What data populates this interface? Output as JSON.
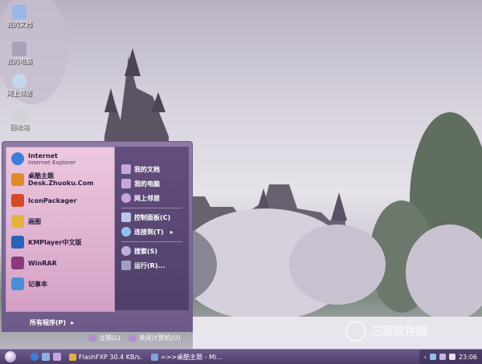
{
  "desktop_icons": [
    {
      "label": "我的文档",
      "icon": "documents-icon",
      "color": "#9bb7e8"
    },
    {
      "label": "我的电脑",
      "icon": "computer-icon",
      "color": "#a7a2b8"
    },
    {
      "label": "网上邻居",
      "icon": "network-icon",
      "color": "#c6d8f0"
    },
    {
      "label": "回收站",
      "icon": "recycle-bin-icon",
      "color": "#d3d3da"
    }
  ],
  "start_menu": {
    "left_items": [
      {
        "title": "Internet",
        "subtitle": "Internet Explorer",
        "icon": "internet-explorer-icon",
        "color": "#3b7fd6"
      },
      {
        "title": "桌酷主题Desk.Zhuoku.Com",
        "icon": "theme-icon",
        "color": "#e08b2b"
      },
      {
        "title": "IconPackager",
        "icon": "iconpackager-icon",
        "color": "#d44a2a"
      },
      {
        "title": "画图",
        "icon": "paint-icon",
        "color": "#e5b33b"
      },
      {
        "title": "KMPlayer中文版",
        "icon": "kmplayer-icon",
        "color": "#2a62b8"
      },
      {
        "title": "WinRAR",
        "icon": "winrar-icon",
        "color": "#8a3a7a"
      },
      {
        "title": "记事本",
        "icon": "notepad-icon",
        "color": "#4a8fd6"
      }
    ],
    "all_programs": "所有程序(P)",
    "right_items": [
      {
        "label": "我的文档",
        "icon": "documents-icon",
        "color": "#c9a6e0"
      },
      {
        "label": "我的电脑",
        "icon": "computer-icon",
        "color": "#c9a6e0"
      },
      {
        "label": "网上邻居",
        "icon": "network-icon",
        "color": "#c9a6e0"
      },
      {
        "label": "控制面板(C)",
        "icon": "control-panel-icon",
        "color": "#b9c8e8"
      },
      {
        "label": "连接到(T)",
        "icon": "connect-icon",
        "color": "#8fc0f0"
      },
      {
        "label": "搜索(S)",
        "icon": "search-icon",
        "color": "#c0b0e0"
      },
      {
        "label": "运行(R)...",
        "icon": "run-icon",
        "color": "#a0a0c0"
      }
    ],
    "logoff": "注销(L)",
    "shutdown": "关闭计算机(U)"
  },
  "taskbar": {
    "tasks": [
      {
        "label": "FlashFXP 30.4 KB/s...",
        "icon": "flashfxp-icon",
        "color": "#e0b040"
      },
      {
        "label": "=>>桌酷主题 - Mi...",
        "icon": "browser-icon",
        "color": "#7aa6e0"
      }
    ],
    "clock": "23:06"
  },
  "watermark": "三联软件园"
}
